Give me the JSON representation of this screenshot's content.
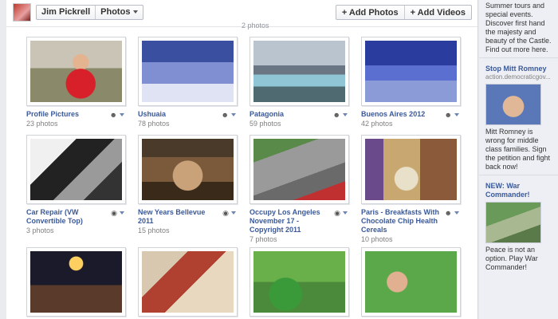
{
  "header": {
    "user_name": "Jim Pickrell",
    "section_label": "Photos",
    "add_photos_label": "+ Add Photos",
    "add_videos_label": "+ Add Videos"
  },
  "stray_caption": "2 photos",
  "albums": [
    {
      "title": "Profile Pictures",
      "count": "23 photos",
      "privacy_icon": "friends-icon"
    },
    {
      "title": "Ushuaia",
      "count": "78 photos",
      "privacy_icon": "friends-icon"
    },
    {
      "title": "Patagonia",
      "count": "59 photos",
      "privacy_icon": "friends-icon"
    },
    {
      "title": "Buenos Aires 2012",
      "count": "42 photos",
      "privacy_icon": "friends-icon"
    },
    {
      "title": "Car Repair (VW Convertible Top)",
      "count": "3 photos",
      "privacy_icon": "globe-icon"
    },
    {
      "title": "New Years Bellevue 2011",
      "count": "15 photos",
      "privacy_icon": "globe-icon"
    },
    {
      "title": "Occupy Los Angeles November 17 - Copyright 2011",
      "count": "7 photos",
      "privacy_icon": "globe-icon"
    },
    {
      "title": "Paris - Breakfasts With Chocolate Chip Health Cereals",
      "count": "10 photos",
      "privacy_icon": "friends-icon"
    },
    {
      "title": "",
      "count": "",
      "privacy_icon": ""
    },
    {
      "title": "",
      "count": "",
      "privacy_icon": ""
    },
    {
      "title": "",
      "count": "",
      "privacy_icon": ""
    },
    {
      "title": "",
      "count": "",
      "privacy_icon": ""
    }
  ],
  "sidebar": {
    "ad1_text": "Summer tours and special events. Discover first hand the majesty and beauty of the Castle. Find out more here.",
    "ad2_title": "Stop Mitt Romney",
    "ad2_domain": "action.democraticgov...",
    "ad2_text": "Mitt Romney is wrong for middle class families. Sign the petition and fight back now!",
    "ad3_title": "NEW: War Commander!",
    "ad3_text": "Peace is not an option. Play War Commander!"
  },
  "colors": {
    "link": "#3b5998",
    "muted": "#808080",
    "page_bg": "#e9ebee"
  }
}
